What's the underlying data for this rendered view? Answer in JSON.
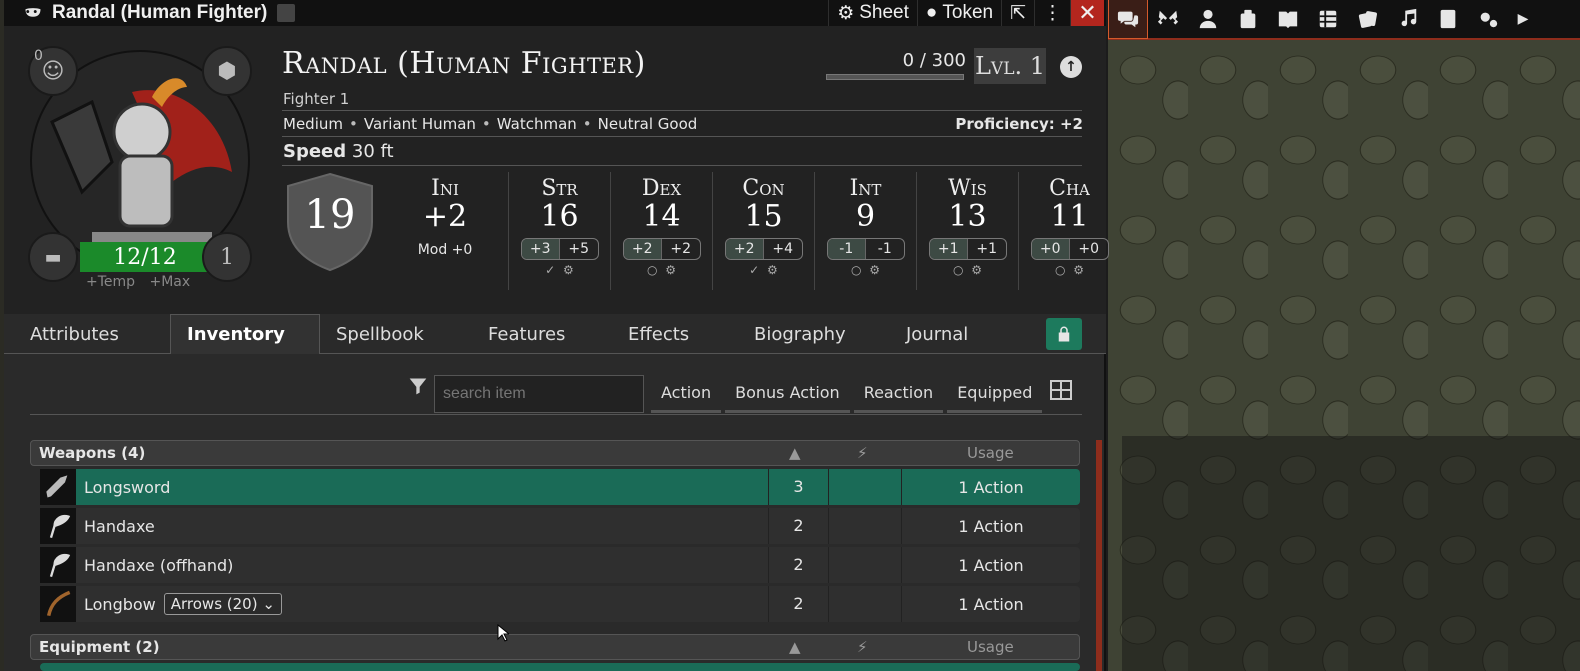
{
  "window": {
    "title": "Randal (Human Fighter)",
    "sheet_label": "Sheet",
    "token_label": "Token",
    "close_label": "✕"
  },
  "character": {
    "name": "Randal (Human Fighter)",
    "class": "Fighter 1",
    "size": "Medium",
    "race": "Variant Human",
    "background": "Watchman",
    "alignment": "Neutral Good",
    "proficiency": "Proficiency: +2",
    "speed_label": "Speed",
    "speed_value": "30 ft",
    "xp": "0 / 300",
    "xp_fraction": 0,
    "level": "Lvl. 1",
    "hp": "12/12",
    "hp_temp": "+Temp",
    "hp_max": "+Max",
    "inspiration": "0",
    "hit_dice": "1",
    "ac": "19"
  },
  "initiative": {
    "name": "Ini",
    "value": "+2",
    "mod": "Mod +0"
  },
  "abilities": [
    {
      "name": "Str",
      "score": "16",
      "mod": "+3",
      "save": "+5"
    },
    {
      "name": "Dex",
      "score": "14",
      "mod": "+2",
      "save": "+2"
    },
    {
      "name": "Con",
      "score": "15",
      "mod": "+2",
      "save": "+4"
    },
    {
      "name": "Int",
      "score": "9",
      "mod": "-1",
      "save": "-1"
    },
    {
      "name": "Wis",
      "score": "13",
      "mod": "+1",
      "save": "+1"
    },
    {
      "name": "Cha",
      "score": "11",
      "mod": "+0",
      "save": "+0"
    }
  ],
  "tabs": [
    "Attributes",
    "Inventory",
    "Spellbook",
    "Features",
    "Effects",
    "Biography",
    "Journal"
  ],
  "search": {
    "placeholder": "search item"
  },
  "filters": [
    "Action",
    "Bonus Action",
    "Reaction",
    "Equipped"
  ],
  "inventory": {
    "usage_header": "Usage",
    "weapons_title": "Weapons (4)",
    "equipment_title": "Equipment (2)",
    "weapons": [
      {
        "name": "Longsword",
        "qty": "3",
        "usage": "1 Action"
      },
      {
        "name": "Handaxe",
        "qty": "2",
        "usage": "1 Action"
      },
      {
        "name": "Handaxe (offhand)",
        "qty": "2",
        "usage": "1 Action"
      },
      {
        "name": "Longbow",
        "ammo": "Arrows (20)",
        "qty": "2",
        "usage": "1 Action"
      }
    ]
  },
  "colors": {
    "accent_green": "#1a6b57",
    "hp_green": "#1b8a2a",
    "close_red": "#b3261e"
  }
}
